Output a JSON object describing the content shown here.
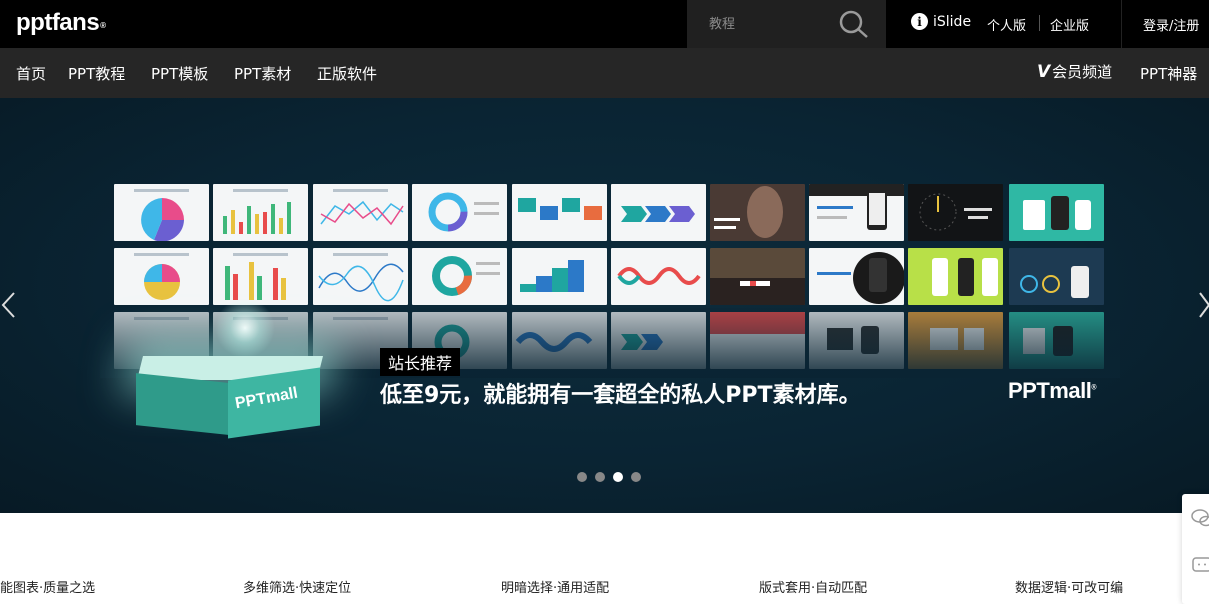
{
  "header": {
    "logo": "pptfans",
    "logo_mark": "®",
    "search_placeholder": "教程",
    "search_icon": "search-icon",
    "islide": {
      "icon_letter": "i",
      "label": "iSlide"
    },
    "personal": "个人版",
    "enterprise": "企业版",
    "login": "登录/注册"
  },
  "nav": {
    "items": [
      "首页",
      "PPT教程",
      "PPT模板",
      "PPT素材",
      "正版软件"
    ],
    "vip_icon": "V",
    "vip_label": "会员频道",
    "tools": "PPT神器"
  },
  "banner": {
    "badge": "站长推荐",
    "headline": "低至9元，就能拥有一套超全的私人PPT素材库。",
    "box_label": "PPTmall",
    "brand": "PPTmall",
    "brand_mark": "®",
    "slide_count": 4,
    "active_slide": 3
  },
  "features": [
    "能图表·质量之选",
    "多维筛选·快速定位",
    "明暗选择·通用适配",
    "版式套用·自动匹配",
    "数据逻辑·可改可编"
  ],
  "colors": {
    "topbar": "#000000",
    "navbar": "#262626",
    "hero": "#0a2433",
    "accent": "#3eb6a2"
  }
}
